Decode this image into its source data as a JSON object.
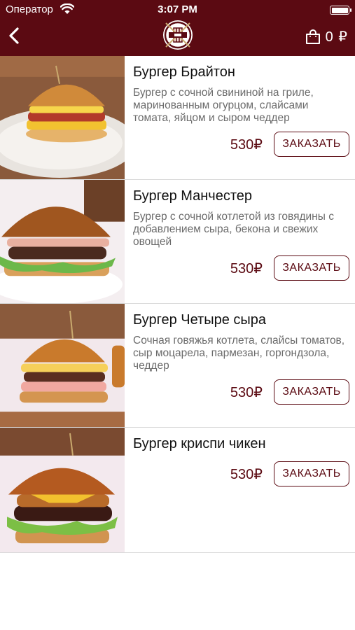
{
  "status_bar": {
    "carrier": "Оператор",
    "time": "3:07 PM"
  },
  "header": {
    "cart_total": "0 ₽",
    "icons": [
      "back-chevron-icon",
      "restaurant-logo",
      "shopping-bag-icon"
    ]
  },
  "colors": {
    "brand": "#5b0a12",
    "price": "#5b0a12",
    "description": "#6b6b6b"
  },
  "products": [
    {
      "name": "Бургер Брайтон",
      "description": "Бургер с сочной свининой на гриле, маринованным огурцом, слайсами томата, яйцом и сыром чеддер",
      "price": "530₽",
      "order_label": "ЗАКАЗАТЬ"
    },
    {
      "name": "Бургер Манчестер",
      "description": "Бургер с сочной котлетой из говядины с добавлением сыра, бекона и свежих овощей",
      "price": "530₽",
      "order_label": "ЗАКАЗАТЬ"
    },
    {
      "name": "Бургер Четыре сыра",
      "description": "Сочная говяжья котлета, слайсы томатов, сыр моцарела, пармезан, горгондзола, чеддер",
      "price": "530₽",
      "order_label": "ЗАКАЗАТЬ"
    },
    {
      "name": "Бургер криспи чикен",
      "description": "",
      "price": "530₽",
      "order_label": "ЗАКАЗАТЬ"
    }
  ]
}
